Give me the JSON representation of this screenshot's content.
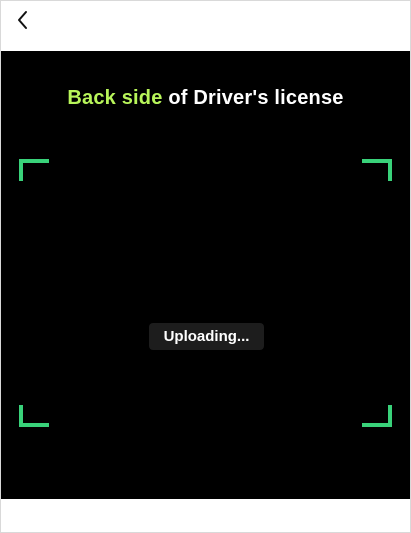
{
  "header": {
    "back_icon": "chevron-left-icon"
  },
  "scanner": {
    "title_highlight": "Back side",
    "title_rest": " of Driver's license",
    "status_text": "Uploading...",
    "frame_color": "#39d27a",
    "highlight_color": "#b8f55a"
  }
}
